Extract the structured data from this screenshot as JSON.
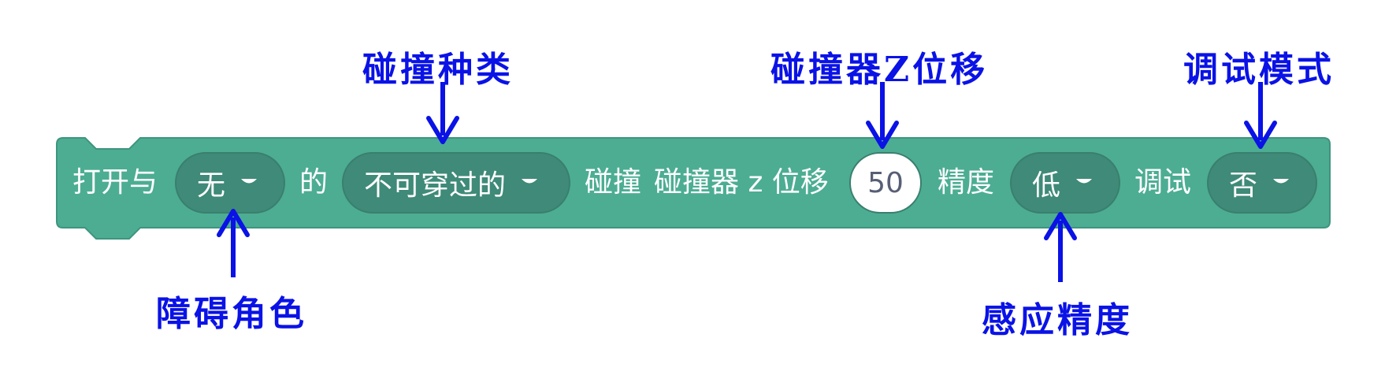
{
  "colors": {
    "block_fill": "#4cad93",
    "block_border": "#3e957e",
    "dropdown_fill": "#3f8a78",
    "annotation": "#0a12e6"
  },
  "block": {
    "prefix_text": "打开与",
    "of_text": "的",
    "collision_text": "碰撞",
    "collider_z_text": "碰撞器 z 位移",
    "precision_text": "精度",
    "debug_text": "调试",
    "obstacle_dropdown": {
      "value": "无",
      "icon": "caret-down-icon"
    },
    "collision_type_dropdown": {
      "value": "不可穿过的",
      "icon": "caret-down-icon"
    },
    "z_offset_input": {
      "value": "50"
    },
    "precision_dropdown": {
      "value": "低",
      "icon": "caret-down-icon"
    },
    "debug_dropdown": {
      "value": "否",
      "icon": "caret-down-icon"
    }
  },
  "annotations": {
    "collision_type": "碰撞种类",
    "collider_z_offset": "碰撞器Z位移",
    "debug_mode": "调试模式",
    "obstacle_sprite": "障碍角色",
    "sensing_precision": "感应精度"
  }
}
